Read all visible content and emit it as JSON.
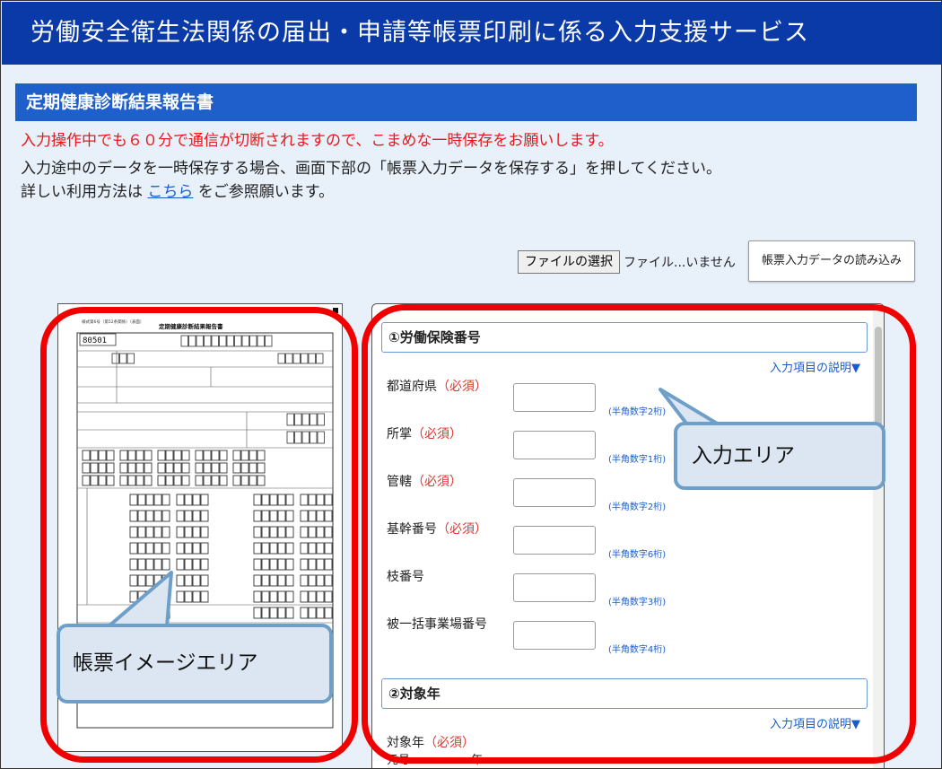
{
  "header": {
    "title": "労働安全衛生法関係の届出・申請等帳票印刷に係る入力支援サービス"
  },
  "form_title": "定期健康診断結果報告書",
  "notices": {
    "warning": "入力操作中でも６０分で通信が切断されますので、こまめな一時保存をお願いします。",
    "save_hint": "入力途中のデータを一時保存する場合、画面下部の「帳票入力データを保存する」を押してください。",
    "usage_prefix": "詳しい利用方法は",
    "usage_link": "こちら",
    "usage_suffix": "をご参照願います。"
  },
  "file_picker": {
    "button_label": "ファイルの選択",
    "status": "ファイル...いません"
  },
  "load_button": "帳票入力データの読み込み",
  "doc_preview": {
    "header_left": "様式第6号（第52条関係）（表面）",
    "title": "定期健康診断結果報告書",
    "code": "80501"
  },
  "sections": [
    {
      "title": "①労働保険番号",
      "help": "入力項目の説明▼",
      "fields": [
        {
          "label": "都道府県",
          "required": "（必須）",
          "hint": "(半角数字2桁)"
        },
        {
          "label": "所掌",
          "required": "（必須）",
          "hint": "(半角数字1桁)"
        },
        {
          "label": "管轄",
          "required": "（必須）",
          "hint": "(半角数字2桁)"
        },
        {
          "label": "基幹番号",
          "required": "（必須）",
          "hint": "(半角数字6桁)"
        },
        {
          "label": "枝番号",
          "required": "",
          "hint": "(半角数字3桁)"
        },
        {
          "label": "被一括事業場番号",
          "required": "",
          "hint": "(半角数字4桁)"
        }
      ]
    },
    {
      "title": "②対象年",
      "help": "入力項目の説明▼",
      "fields": [
        {
          "label": "対象年",
          "required": "（必須）"
        }
      ],
      "era_prefix": "元号",
      "year_suffix": "年"
    }
  ],
  "callouts": {
    "doc_area": "帳票イメージエリア",
    "input_area": "入力エリア"
  },
  "colors": {
    "header": "#0a3aa8",
    "title_bar": "#1e5fcc",
    "warning": "#e8171a",
    "highlight": "#f10000",
    "callout_fill": "#dce6f2",
    "callout_border": "#6e9fc9"
  }
}
